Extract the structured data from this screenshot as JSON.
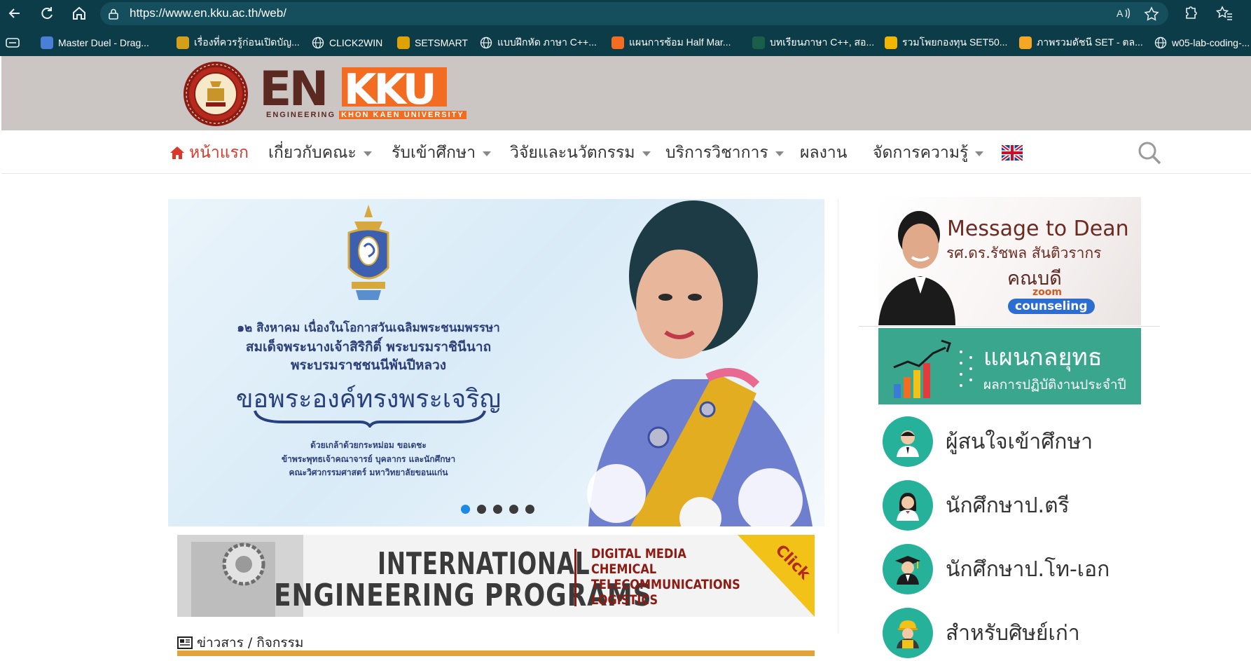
{
  "browser": {
    "url": "https://www.en.kku.ac.th/web/",
    "bookmarks": [
      {
        "label": "Master Duel - Drag...",
        "color": "#4a7fd6"
      },
      {
        "label": "เรื่องที่ควรรู้ก่อนเปิดบัญ...",
        "color": "#d4a019"
      },
      {
        "label": "CLICK2WIN",
        "color": "globe"
      },
      {
        "label": "SETSMART",
        "color": "#e0a200"
      },
      {
        "label": "แบบฝึกหัด ภาษา C++...",
        "color": "globe"
      },
      {
        "label": "แผนการซ้อม Half Mar...",
        "color": "#f26c22"
      },
      {
        "label": "บทเรียนภาษา C++, สอ...",
        "color": "#1b5e4a"
      },
      {
        "label": "รวมโพยกองทุน SET50...",
        "color": "#f2b600"
      },
      {
        "label": "ภาพรวมดัชนี SET - ตล...",
        "color": "#f5a623"
      },
      {
        "label": "w05-lab-coding-...",
        "color": "globe"
      }
    ]
  },
  "site": {
    "logo": {
      "main": "ENKKU",
      "sub_engineering": "ENGINEERING",
      "sub_kku": "KHON KAEN UNIVERSITY"
    },
    "menu": [
      {
        "label": "หน้าแรก",
        "active": true,
        "dropdown": false
      },
      {
        "label": "เกี่ยวกับคณะ",
        "active": false,
        "dropdown": true
      },
      {
        "label": "รับเข้าศึกษา",
        "active": false,
        "dropdown": true
      },
      {
        "label": "วิจัยและนวัตกรรม",
        "active": false,
        "dropdown": true
      },
      {
        "label": "บริการวิชาการ",
        "active": false,
        "dropdown": true
      },
      {
        "label": "ผลงาน",
        "active": false,
        "dropdown": false
      },
      {
        "label": "จัดการความรู้",
        "active": false,
        "dropdown": true
      }
    ],
    "hero": {
      "line1": "๑๒ สิงหาคม เนื่องในโอกาสวันเฉลิมพระชนมพรรษา",
      "line2": "สมเด็จพระนางเจ้าสิริกิติ์ พระบรมราชินีนาถ",
      "line3": "พระบรมราชชนนีพันปีหลวง",
      "title": "ขอพระองค์ทรงพระเจริญ",
      "line5": "ด้วยเกล้าด้วยกระหม่อม ขอเดชะ",
      "line6": "ข้าพระพุทธเจ้าคณาจารย์ บุคลากร และนักศึกษา",
      "line7": "คณะวิศวกรรมศาสตร์ มหาวิทยาลัยขอนแก่น",
      "slides_total": 5,
      "active_slide": 1
    },
    "intl": {
      "line1": "INTERNATIONAL",
      "line2": "ENGINEERING PROGRAMS",
      "programs": [
        "DIGITAL MEDIA",
        "CHEMICAL",
        "TELECOMMUNICATIONS",
        "LOGISTICS"
      ],
      "click": "Click"
    },
    "news": {
      "label": "ข่าวสาร / กิจกรรม"
    },
    "dean": {
      "title": "Message to Dean",
      "name": "รศ.ดร.รัชพล สันติวรากร",
      "role": "คณบดี",
      "zoom": "zoom",
      "counseling": "counseling"
    },
    "plan": {
      "title": "แผนกลยุทธ",
      "subtitle": "ผลการปฏิบัติงานประจำปี"
    },
    "quick_links": [
      {
        "label": "ผู้สนใจเข้าศึกษา",
        "icon": "applicant"
      },
      {
        "label": "นักศึกษาป.ตรี",
        "icon": "undergraduate"
      },
      {
        "label": "นักศึกษาป.โท-เอก",
        "icon": "graduate"
      },
      {
        "label": "สำหรับศิษย์เก่า",
        "icon": "alumni"
      }
    ]
  }
}
